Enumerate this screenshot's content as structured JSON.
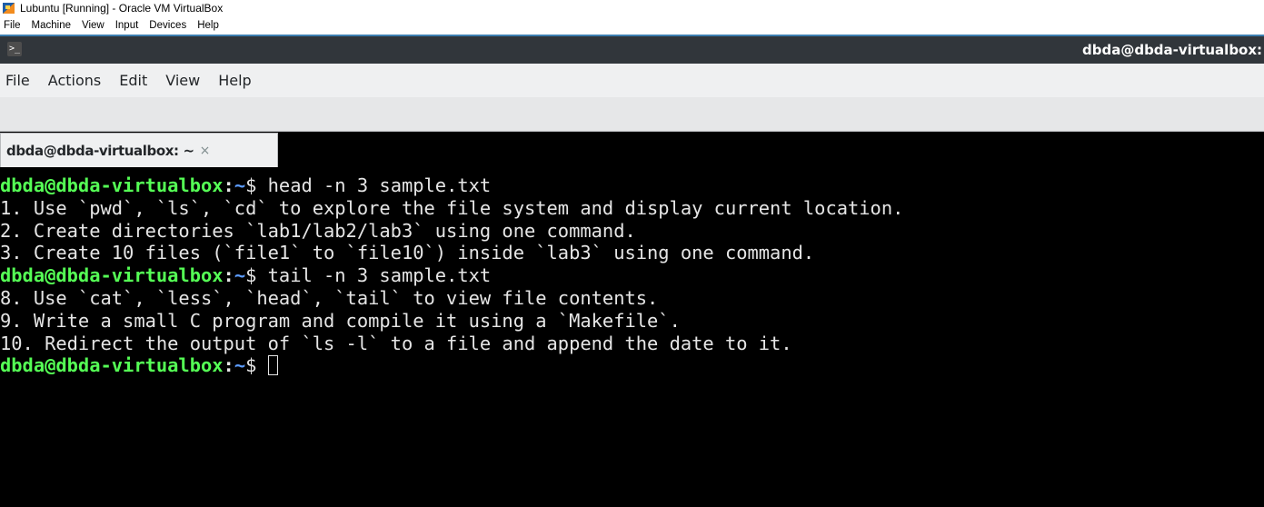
{
  "host_window": {
    "title": "Lubuntu [Running] - Oracle VM VirtualBox",
    "menu": [
      "File",
      "Machine",
      "View",
      "Input",
      "Devices",
      "Help"
    ]
  },
  "guest_window": {
    "title": "dbda@dbda-virtualbox: ~"
  },
  "terminal_app": {
    "menu": [
      "File",
      "Actions",
      "Edit",
      "View",
      "Help"
    ],
    "tabs": [
      {
        "label": "dbda@dbda-virtualbox: ~",
        "close_glyph": "×",
        "active": true
      }
    ]
  },
  "terminal": {
    "prompt_user": "dbda@dbda-virtualbox",
    "prompt_colon": ":",
    "prompt_path": "~",
    "prompt_symbol": "$",
    "lines": [
      {
        "type": "prompt",
        "command": "head -n 3 sample.txt"
      },
      {
        "type": "output",
        "text": "1. Use `pwd`, `ls`, `cd` to explore the file system and display current location."
      },
      {
        "type": "output",
        "text": "2. Create directories `lab1/lab2/lab3` using one command."
      },
      {
        "type": "output",
        "text": "3. Create 10 files (`file1` to `file10`) inside `lab3` using one command."
      },
      {
        "type": "prompt",
        "command": "tail -n 3 sample.txt"
      },
      {
        "type": "output",
        "text": "8. Use `cat`, `less`, `head`, `tail` to view file contents."
      },
      {
        "type": "output",
        "text": "9. Write a small C program and compile it using a `Makefile`."
      },
      {
        "type": "output",
        "text": "10. Redirect the output of `ls -l` to a file and append the date to it."
      },
      {
        "type": "prompt",
        "command": "",
        "cursor": true
      }
    ]
  },
  "icons": {
    "host_app": "virtualbox-logo-icon",
    "guest_app": "terminal-icon",
    "tab_close": "close-icon"
  },
  "colors": {
    "prompt_user": "#55ff55",
    "prompt_path": "#5c9cff",
    "terminal_bg": "#000000",
    "terminal_fg": "#e5e5e5",
    "guest_titlebar": "#31363b"
  }
}
